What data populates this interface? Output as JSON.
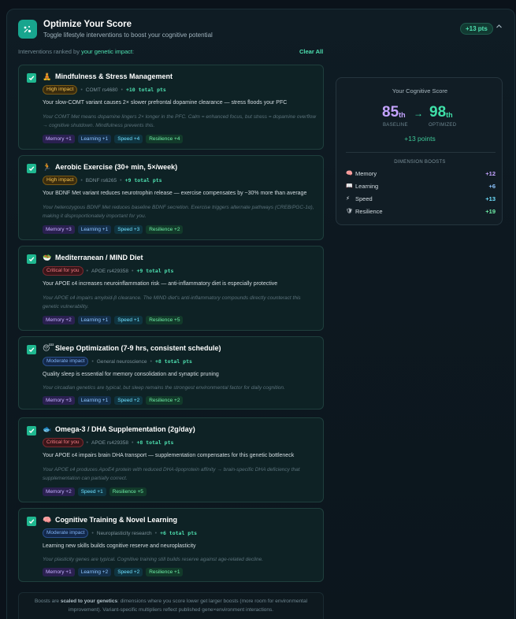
{
  "header": {
    "title": "Optimize Your Score",
    "subtitle": "Toggle lifestyle interventions to boost your cognitive potential",
    "pts_badge": "+13 pts",
    "collapse_icon": "chevron-up-icon"
  },
  "ranked": {
    "prefix": "Interventions ranked by",
    "highlight": "your genetic impact",
    "suffix": ":",
    "clear_label": "Clear All"
  },
  "interventions": [
    {
      "checked": true,
      "emoji": "🧘",
      "title": "Mindfulness & Stress Management",
      "impact": "High impact",
      "impact_level": "high",
      "source": "COMT rs4680",
      "total": "+10 total pts",
      "description": "Your slow-COMT variant causes 2× slower prefrontal dopamine clearance — stress floods your PFC",
      "note": "Your COMT Met means dopamine lingers 2× longer in the PFC. Calm = enhanced focus, but stress = dopamine overflow → cognitive shutdown. Mindfulness prevents this.",
      "tags": [
        "Memory +1",
        "Learning +1",
        "Speed +4",
        "Resilience +4"
      ]
    },
    {
      "checked": true,
      "emoji": "🏃",
      "title": "Aerobic Exercise (30+ min, 5×/week)",
      "impact": "High impact",
      "impact_level": "high",
      "source": "BDNF rs6265",
      "total": "+9 total pts",
      "description": "Your BDNF Met variant reduces neurotrophin release — exercise compensates by ~30% more than average",
      "note": "Your heterozygous BDNF Met reduces baseline BDNF secretion. Exercise triggers alternate pathways (CREB/PGC-1α), making it disproportionately important for you.",
      "tags": [
        "Memory +3",
        "Learning +1",
        "Speed +3",
        "Resilience +2"
      ]
    },
    {
      "checked": true,
      "emoji": "🥗",
      "title": "Mediterranean / MIND Diet",
      "impact": "Critical for you",
      "impact_level": "critical",
      "source": "APOE rs429358",
      "total": "+9 total pts",
      "description": "Your APOE ε4 increases neuroinflammation risk — anti-inflammatory diet is especially protective",
      "note": "Your APOE ε4 impairs amyloid-β clearance. The MIND diet's anti-inflammatory compounds directly counteract this genetic vulnerability.",
      "tags": [
        "Memory +2",
        "Learning +1",
        "Speed +1",
        "Resilience +5"
      ]
    },
    {
      "checked": true,
      "emoji": "😴",
      "title": "Sleep Optimization (7-9 hrs, consistent schedule)",
      "impact": "Moderate impact",
      "impact_level": "moderate",
      "source": "General neuroscience",
      "total": "+8 total pts",
      "description": "Quality sleep is essential for memory consolidation and synaptic pruning",
      "note": "Your circadian genetics are typical, but sleep remains the strongest environmental factor for daily cognition.",
      "tags": [
        "Memory +3",
        "Learning +1",
        "Speed +2",
        "Resilience +2"
      ]
    },
    {
      "checked": true,
      "emoji": "🐟",
      "title": "Omega-3 / DHA Supplementation (2g/day)",
      "impact": "Critical for you",
      "impact_level": "critical",
      "source": "APOE rs429358",
      "total": "+8 total pts",
      "description": "Your APOE ε4 impairs brain DHA transport — supplementation compensates for this genetic bottleneck",
      "note": "Your APOE ε4 produces ApoE4 protein with reduced DHA-lipoprotein affinity → brain-specific DHA deficiency that supplementation can partially correct.",
      "tags": [
        "Memory +2",
        "Speed +1",
        "Resilience +5"
      ]
    },
    {
      "checked": true,
      "emoji": "🧠",
      "title": "Cognitive Training & Novel Learning",
      "impact": "Moderate impact",
      "impact_level": "moderate",
      "source": "Neuroplasticity research",
      "total": "+6 total pts",
      "description": "Learning new skills builds cognitive reserve and neuroplasticity",
      "note": "Your plasticity genes are typical. Cognitive training still builds reserve against age-related decline.",
      "tags": [
        "Memory +1",
        "Learning +2",
        "Speed +2",
        "Resilience +1"
      ]
    }
  ],
  "footnote": {
    "prefix": "Boosts are",
    "bold": "scaled to your genetics",
    "rest": ": dimensions where you score lower get larger boosts (more room for environmental improvement). Variant-specific multipliers reflect published gene×environment interactions."
  },
  "score": {
    "title": "Your Cognitive Score",
    "baseline_value": "85",
    "baseline_suffix": "th",
    "baseline_label": "BASELINE",
    "arrow": "→",
    "optimized_value": "98",
    "optimized_suffix": "th",
    "optimized_label": "OPTIMIZED",
    "gain": "+13 points",
    "dimension_heading": "DIMENSION BOOSTS",
    "dimensions": [
      {
        "icon": "🧠",
        "icon_name": "brain-icon",
        "label": "Memory",
        "value": "+12",
        "color": "#c4a3ff"
      },
      {
        "icon": "📖",
        "icon_name": "book-icon",
        "label": "Learning",
        "value": "+6",
        "color": "#8ec5ff"
      },
      {
        "icon": "⚡",
        "icon_name": "lightning-icon",
        "label": "Speed",
        "value": "+13",
        "color": "#6ee0ff"
      },
      {
        "icon": "🛡",
        "icon_name": "shield-icon",
        "label": "Resilience",
        "value": "+19",
        "color": "#6ff0a8"
      }
    ]
  }
}
